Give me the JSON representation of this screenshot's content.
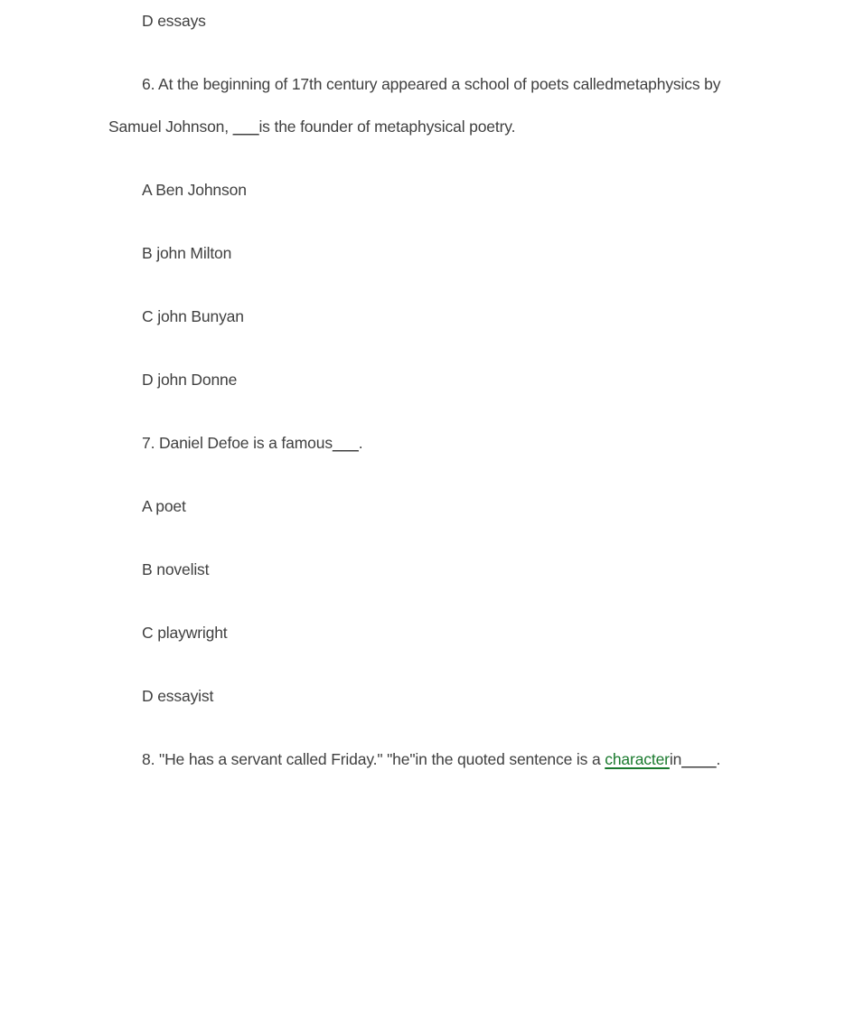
{
  "document": {
    "background_color": "#ffffff",
    "text_color": "#404040",
    "link_color": "#1a7a2e"
  },
  "content": {
    "prev_question_tail": {
      "option_d": "D essays"
    },
    "question6": {
      "text": "6. At the beginning of 17th century appeared a school of poets called metaphysics by Samuel Johnson, ___is the founder of metaphysical poetry.",
      "line1": "6. At the beginning of 17th century appeared a school of poets called",
      "line2_before_blank": "metaphysics by Samuel Johnson, ",
      "line2_blank": "___",
      "line2_after_blank": "is the founder of metaphysical poetry.",
      "options": [
        "A Ben Johnson",
        "B john Milton",
        "C john Bunyan",
        "D john Donne"
      ]
    },
    "question7": {
      "text": "7. Daniel Defoe is a famous___.",
      "stem_before_blank": "7. Daniel Defoe is a famous",
      "blank": "___",
      "stem_after_blank": ".",
      "options": [
        "A poet",
        "B novelist",
        "C playwright",
        "D essayist"
      ]
    },
    "question8": {
      "text": "8. \"He has a servant called Friday.\" \"he\"in the quoted sentence is a character in____.",
      "line1_before_link": "8. \"He has a servant called Friday.\" \"he\"in the quoted sentence is a ",
      "link_text": "character",
      "line2_before_blank": "in",
      "line2_blank": "____",
      "line2_after_blank": "."
    }
  }
}
